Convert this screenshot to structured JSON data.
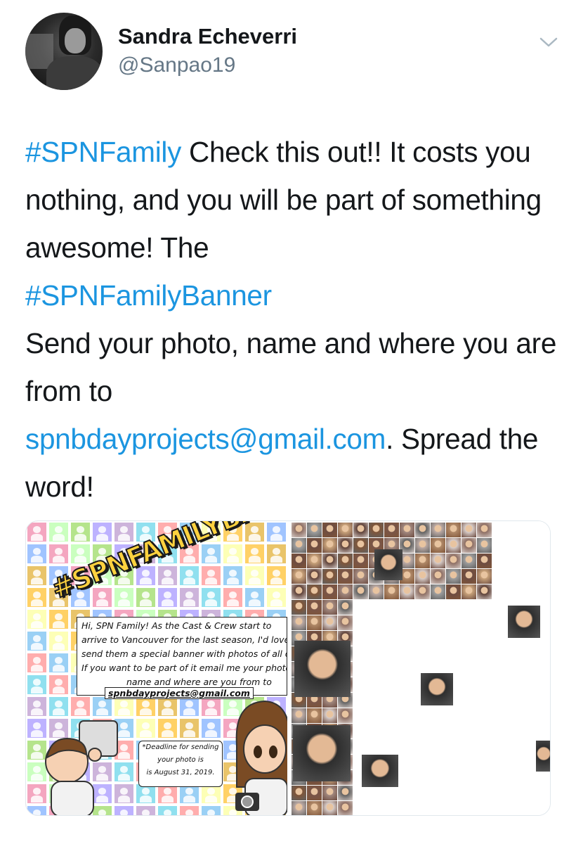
{
  "user": {
    "display_name": "Sandra Echeverri",
    "handle": "@Sanpao19"
  },
  "icons": {
    "avatar": "user-avatar",
    "caret": "chevron-down-icon"
  },
  "tweet": {
    "hashtag1": "#SPNFamily",
    "text1": " Check this out!! It costs you nothing, and you will be part of something awesome! The",
    "hashtag2": "#SPNFamilyBanner",
    "text2": "Send your photo, name and where you are from to",
    "email": "spnbdayprojects@gmail.com",
    "text3": ". Spread the word!"
  },
  "media": {
    "banner_title": "#SPNFAMILYBANNE",
    "message_lines": [
      "Hi, SPN Family! As the Cast & Crew start to",
      "arrive to Vancouver for the last season, I'd love to",
      "send them a special banner with photos of all of us",
      "If you want to be part of it email me your photo,",
      "name and where are you from to"
    ],
    "message_email": "spnbdayprojects@gmail.com",
    "deadline_lines": [
      "*Deadline for sending",
      "your photo is",
      "is August 31, 2019."
    ]
  },
  "colors": {
    "link": "#1b95e0",
    "text": "#14171a",
    "secondary": "#657786"
  }
}
